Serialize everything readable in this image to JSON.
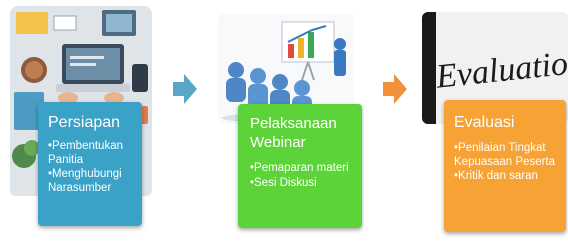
{
  "colors": {
    "stage1": "#3aa1c7",
    "stage2": "#5cd439",
    "stage3": "#f7a234",
    "arrow1": "#5aa6c8",
    "arrow2": "#f2913c"
  },
  "stages": [
    {
      "title": "Persiapan",
      "bullets": [
        "Pembentukan Panitia",
        "Menghubungi Narasumber"
      ],
      "image_icon": "office-desk-illustration-icon"
    },
    {
      "title": "Pelaksanaan Webinar",
      "bullets": [
        "Pemaparan materi",
        "Sesi Diskusi"
      ],
      "image_icon": "presentation-audience-icon"
    },
    {
      "title": "Evaluasi",
      "bullets": [
        "Penilaian Tingkat Kepuasaan Peserta",
        "Kritik dan saran"
      ],
      "image_icon": "evaluation-word-art-icon",
      "image_text": "Evaluation"
    }
  ],
  "arrows": [
    "arrow-right-icon",
    "arrow-right-icon"
  ]
}
